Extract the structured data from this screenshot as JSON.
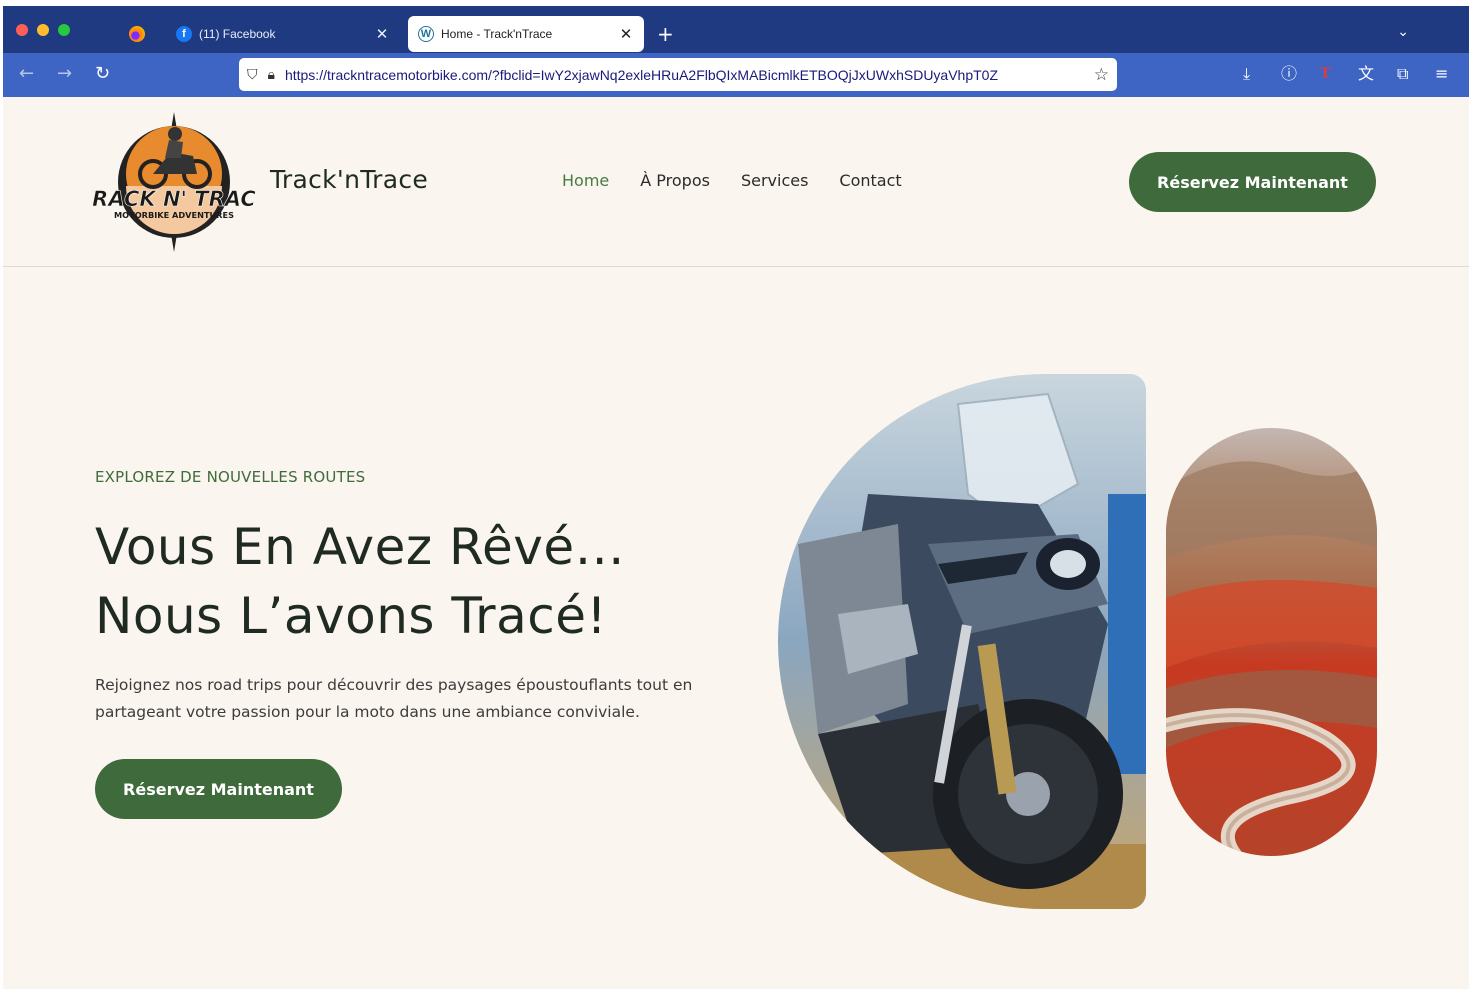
{
  "browser": {
    "tabs": [
      {
        "label": "(11) Facebook",
        "icon": "facebook-icon",
        "active": false
      },
      {
        "label": "Home - Track'nTrace",
        "icon": "wordpress-icon",
        "active": true
      }
    ],
    "url": "https://trackntracemotorbike.com/?fbclid=IwY2xjawNq2exleHRuA2FlbQIxMABicmlkETBOQjJxUWxhSDUyaVhpT0Z"
  },
  "site": {
    "logo_text": "TRACK N' TRACE",
    "logo_subtext": "MOTORBIKE ADVENTURES",
    "brand": "Track'nTrace",
    "nav": [
      {
        "label": "Home",
        "active": true
      },
      {
        "label": "À Propos",
        "active": false
      },
      {
        "label": "Services",
        "active": false
      },
      {
        "label": "Contact",
        "active": false
      }
    ],
    "header_cta": "Réservez Maintenant"
  },
  "hero": {
    "eyebrow": "EXPLOREZ DE NOUVELLES ROUTES",
    "title_line1": "Vous En Avez Rêvé…",
    "title_line2": "Nous L’avons Tracé!",
    "description": "Rejoignez nos road trips pour découvrir des paysages époustouflants tout en partageant votre passion pour la moto dans une ambiance conviviale.",
    "cta": "Réservez Maintenant"
  },
  "colors": {
    "chrome_tabbar": "#1f3a80",
    "chrome_navbar": "#3e65c4",
    "page_bg": "#faf5ee",
    "accent_green": "#3e6a3c",
    "text_dark": "#1f2a22"
  }
}
